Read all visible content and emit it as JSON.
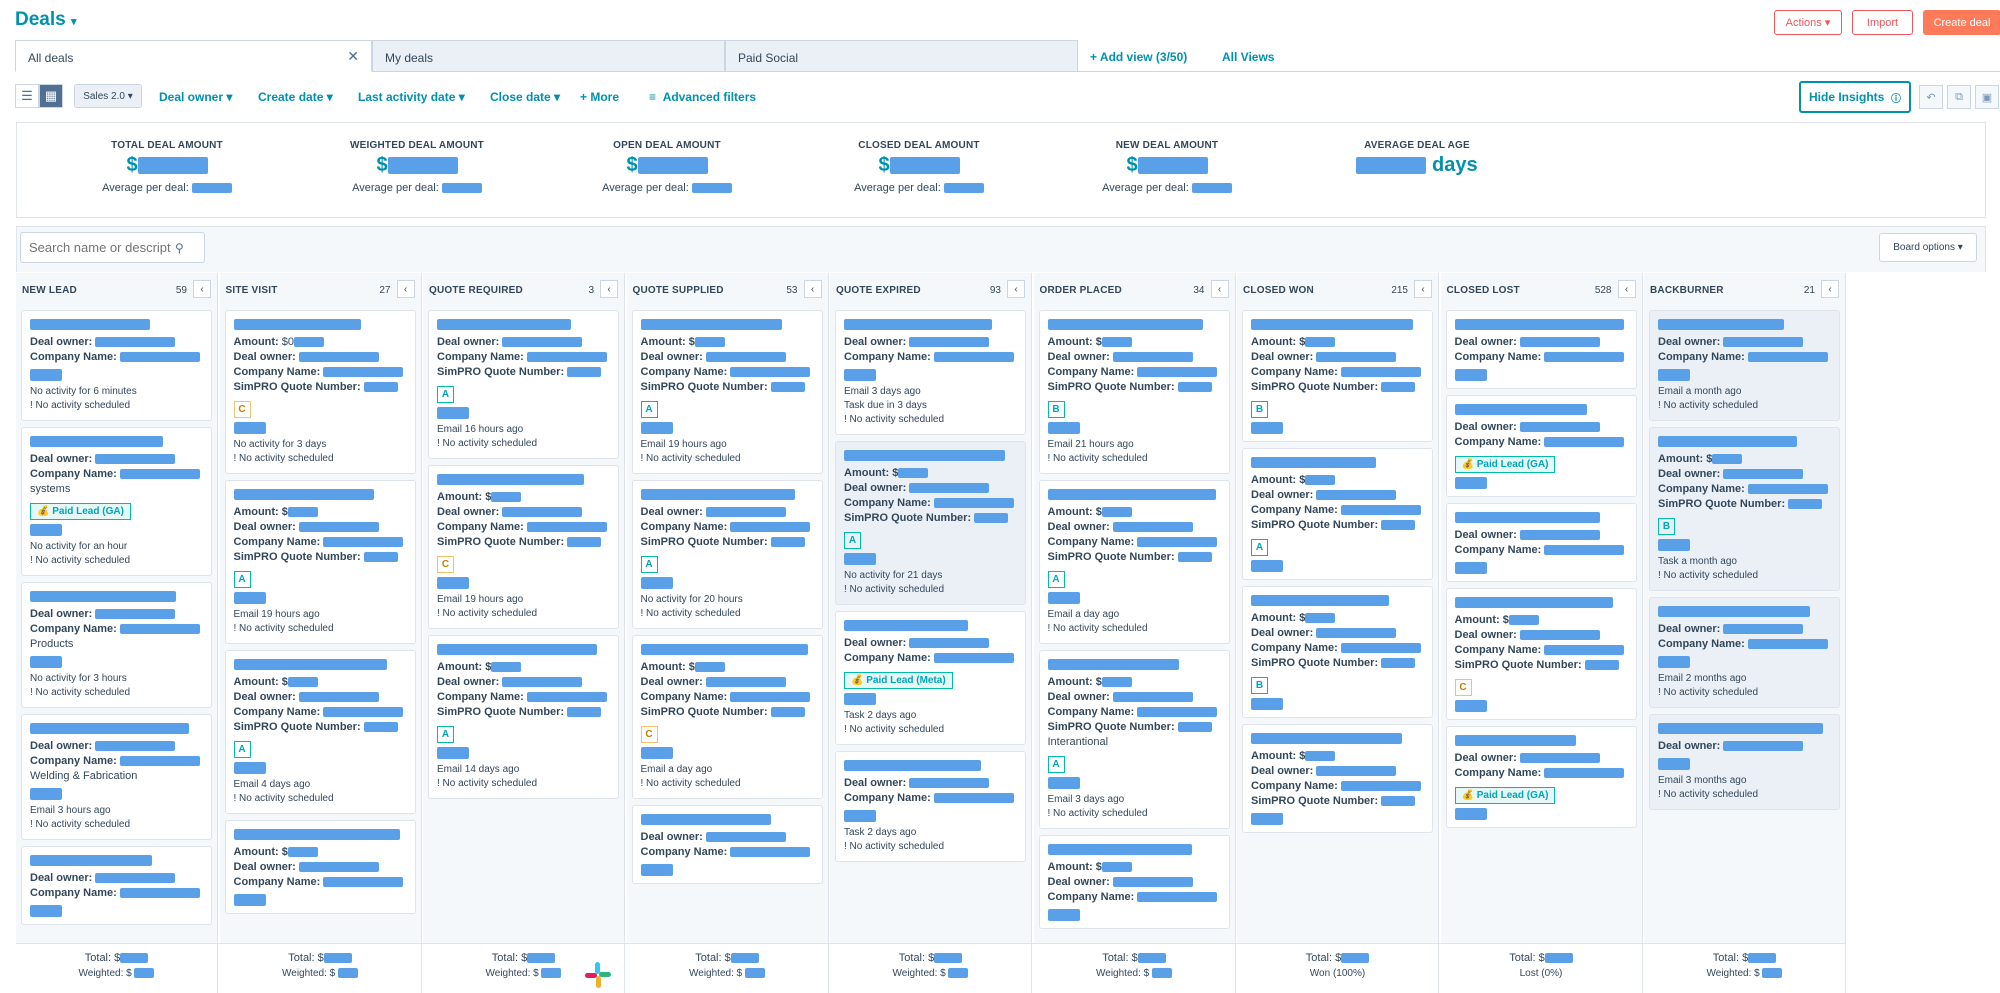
{
  "header": {
    "title": "Deals"
  },
  "top_buttons": {
    "actions": "Actions",
    "import": "Import",
    "create": "Create deal"
  },
  "tabs": {
    "all": "All deals",
    "mine": "My deals",
    "paid_social": "Paid Social",
    "add_view": "+ Add view (3/50)",
    "all_views": "All Views"
  },
  "filters": {
    "pipeline": "Sales 2.0",
    "deal_owner": "Deal owner",
    "create_date": "Create date",
    "last_activity": "Last activity date",
    "close_date": "Close date",
    "more": "+ More",
    "advanced": "Advanced filters",
    "hide_insights": "Hide Insights"
  },
  "insights": [
    {
      "label": "TOTAL DEAL AMOUNT",
      "prefix": "$",
      "suffix": "",
      "sub": "Average per deal:"
    },
    {
      "label": "WEIGHTED DEAL AMOUNT",
      "prefix": "$",
      "suffix": "",
      "sub": "Average per deal:"
    },
    {
      "label": "OPEN DEAL AMOUNT",
      "prefix": "$",
      "suffix": "",
      "sub": "Average per deal:"
    },
    {
      "label": "CLOSED DEAL AMOUNT",
      "prefix": "$",
      "suffix": "",
      "sub": "Average per deal:"
    },
    {
      "label": "NEW DEAL AMOUNT",
      "prefix": "$",
      "suffix": "",
      "sub": "Average per deal:"
    },
    {
      "label": "AVERAGE DEAL AGE",
      "prefix": "",
      "suffix": "days",
      "sub": ""
    }
  ],
  "search": {
    "placeholder": "Search name or descript"
  },
  "board_options": "Board options",
  "labels": {
    "amount": "Amount:",
    "owner": "Deal owner:",
    "company": "Company Name:",
    "quote": "SimPRO Quote Number:",
    "no_activity": "No activity scheduled",
    "total": "Total:",
    "weighted": "Weighted:"
  },
  "columns": [
    {
      "name": "NEW LEAD",
      "count": "59",
      "total_label": "Total: $",
      "weighted_label": "Weighted: $",
      "cards": [
        {
          "lines": [
            "owner",
            "company"
          ],
          "extra": "",
          "badge": "",
          "tag": "",
          "activity": "No activity for 6 minutes"
        },
        {
          "lines": [
            "owner",
            "company"
          ],
          "extra": "systems",
          "badge": "",
          "tag": "Paid Lead (GA)",
          "activity": "No activity for an hour"
        },
        {
          "lines": [
            "owner",
            "company"
          ],
          "extra": "Products",
          "badge": "",
          "tag": "",
          "activity": "No activity for 3 hours"
        },
        {
          "lines": [
            "owner",
            "company"
          ],
          "extra": "Welding & Fabrication",
          "badge": "",
          "tag": "",
          "activity": "Email 3 hours ago"
        },
        {
          "lines": [
            "owner",
            "company"
          ],
          "extra": "",
          "badge": "",
          "tag": "",
          "activity": ""
        }
      ]
    },
    {
      "name": "SITE VISIT",
      "count": "27",
      "total_label": "Total: $",
      "weighted_label": "Weighted: $",
      "cards": [
        {
          "lines": [
            "amount0",
            "owner",
            "company",
            "quote"
          ],
          "extra": "",
          "badge": "C",
          "tag": "",
          "activity": "No activity for 3 days"
        },
        {
          "lines": [
            "amount",
            "owner",
            "company",
            "quote"
          ],
          "extra": "",
          "badge": "A",
          "tag": "",
          "activity": "Email 19 hours ago"
        },
        {
          "lines": [
            "amount",
            "owner",
            "company",
            "quote"
          ],
          "extra": "",
          "badge": "A",
          "tag": "",
          "activity": "Email 4 days ago"
        },
        {
          "lines": [
            "amount",
            "owner",
            "company"
          ],
          "extra": "",
          "badge": "",
          "tag": "",
          "activity": ""
        }
      ]
    },
    {
      "name": "QUOTE REQUIRED",
      "count": "3",
      "total_label": "Total: $",
      "weighted_label": "Weighted: $",
      "cards": [
        {
          "lines": [
            "owner",
            "company",
            "quote"
          ],
          "extra": "",
          "badge": "A",
          "tag": "",
          "activity": "Email 16 hours ago"
        },
        {
          "lines": [
            "amount",
            "owner",
            "company",
            "quote"
          ],
          "extra": "",
          "badge": "C",
          "tag": "",
          "activity": "Email 19 hours ago"
        },
        {
          "lines": [
            "amount",
            "owner",
            "company",
            "quote"
          ],
          "extra": "",
          "badge": "A",
          "tag": "",
          "activity": "Email 14 days ago"
        }
      ]
    },
    {
      "name": "QUOTE SUPPLIED",
      "count": "53",
      "total_label": "Total: $",
      "weighted_label": "Weighted: $",
      "cards": [
        {
          "lines": [
            "amount",
            "owner",
            "company",
            "quote"
          ],
          "extra": "",
          "badge": "A",
          "tag": "",
          "activity": "Email 19 hours ago"
        },
        {
          "lines": [
            "owner",
            "company",
            "quote"
          ],
          "extra": "",
          "badge": "A",
          "tag": "",
          "activity": "No activity for 20 hours"
        },
        {
          "lines": [
            "amount",
            "owner",
            "company",
            "quote"
          ],
          "extra": "",
          "badge": "C",
          "tag": "",
          "activity": "Email a day ago"
        },
        {
          "lines": [
            "owner",
            "company"
          ],
          "extra": "",
          "badge": "",
          "tag": "",
          "activity": ""
        }
      ]
    },
    {
      "name": "QUOTE EXPIRED",
      "count": "93",
      "total_label": "Total: $",
      "weighted_label": "Weighted: $",
      "cards": [
        {
          "lines": [
            "owner",
            "company"
          ],
          "extra": "",
          "badge": "",
          "tag": "",
          "activity": "Email 3 days ago",
          "task": "Task due in 3 days"
        },
        {
          "lines": [
            "amount",
            "owner",
            "company",
            "quote"
          ],
          "extra": "",
          "badge": "A",
          "tag": "",
          "activity": "No activity for 21 days",
          "hl": true
        },
        {
          "lines": [
            "owner",
            "company"
          ],
          "extra": "",
          "badge": "",
          "tag": "Paid Lead (Meta)",
          "activity": "Task 2 days ago"
        },
        {
          "lines": [
            "owner",
            "company"
          ],
          "extra": "",
          "badge": "",
          "tag": "",
          "activity": "Task 2 days ago"
        }
      ]
    },
    {
      "name": "ORDER PLACED",
      "count": "34",
      "total_label": "Total: $",
      "weighted_label": "Weighted: $",
      "cards": [
        {
          "lines": [
            "amount",
            "owner",
            "company",
            "quote"
          ],
          "extra": "",
          "badge": "B",
          "tag": "",
          "activity": "Email 21 hours ago"
        },
        {
          "lines": [
            "amount",
            "owner",
            "company",
            "quote"
          ],
          "extra": "",
          "badge": "A",
          "tag": "",
          "activity": "Email a day ago"
        },
        {
          "lines": [
            "amount",
            "owner",
            "company",
            "quote"
          ],
          "extra": "Interantional",
          "badge": "A",
          "tag": "",
          "activity": "Email 3 days ago"
        },
        {
          "lines": [
            "amount",
            "owner",
            "company"
          ],
          "extra": "",
          "badge": "",
          "tag": "",
          "activity": ""
        }
      ]
    },
    {
      "name": "CLOSED WON",
      "count": "215",
      "total_label": "Total: $",
      "weighted_label": "Won (100%)",
      "cards": [
        {
          "lines": [
            "amount",
            "owner",
            "company",
            "quote"
          ],
          "extra": "",
          "badge": "B",
          "tag": "",
          "activity": ""
        },
        {
          "lines": [
            "amount",
            "owner",
            "company",
            "quote"
          ],
          "extra": "",
          "badge": "A",
          "tag": "",
          "activity": ""
        },
        {
          "lines": [
            "amount",
            "owner",
            "company",
            "quote"
          ],
          "extra": "",
          "badge": "B",
          "tag": "",
          "activity": ""
        },
        {
          "lines": [
            "amount",
            "owner",
            "company",
            "quote"
          ],
          "extra": "",
          "badge": "",
          "tag": "",
          "activity": ""
        }
      ]
    },
    {
      "name": "CLOSED LOST",
      "count": "528",
      "total_label": "Total: $",
      "weighted_label": "Lost (0%)",
      "cards": [
        {
          "lines": [
            "owner",
            "company"
          ],
          "extra": "",
          "badge": "",
          "tag": "",
          "activity": ""
        },
        {
          "lines": [
            "owner",
            "company"
          ],
          "extra": "",
          "badge": "",
          "tag": "Paid Lead (GA)",
          "activity": ""
        },
        {
          "lines": [
            "owner",
            "company"
          ],
          "extra": "",
          "badge": "",
          "tag": "",
          "activity": ""
        },
        {
          "lines": [
            "amount",
            "owner",
            "company",
            "quote"
          ],
          "extra": "",
          "badge": "C",
          "tag": "",
          "activity": ""
        },
        {
          "lines": [
            "owner",
            "company"
          ],
          "extra": "",
          "badge": "",
          "tag": "Paid Lead (GA)",
          "activity": ""
        }
      ]
    },
    {
      "name": "BACKBURNER",
      "count": "21",
      "total_label": "Total: $",
      "weighted_label": "Weighted: $",
      "cards": [
        {
          "lines": [
            "owner",
            "company"
          ],
          "extra": "",
          "badge": "",
          "tag": "",
          "activity": "Email a month ago",
          "hl": true
        },
        {
          "lines": [
            "amount",
            "owner",
            "company",
            "quote"
          ],
          "extra": "",
          "badge": "B",
          "tag": "",
          "activity": "Task a month ago",
          "hl": true
        },
        {
          "lines": [
            "owner",
            "company"
          ],
          "extra": "",
          "badge": "",
          "tag": "",
          "activity": "Email 2 months ago",
          "hl": true
        },
        {
          "lines": [
            "owner"
          ],
          "extra": "",
          "badge": "",
          "tag": "",
          "activity": "Email 3 months ago",
          "hl": true
        }
      ]
    }
  ],
  "colors": {
    "accent": "#0091ae",
    "create": "#ff7a59",
    "redaction": "#5aa0e8",
    "border": "#dfe3eb"
  },
  "icons": [
    "caret-down-icon",
    "close-icon",
    "list-view-icon",
    "board-view-icon",
    "filter-icon",
    "info-icon",
    "search-icon",
    "undo-icon",
    "copy-icon",
    "save-icon",
    "chevron-left-icon",
    "money-bag-icon",
    "slack-icon"
  ]
}
